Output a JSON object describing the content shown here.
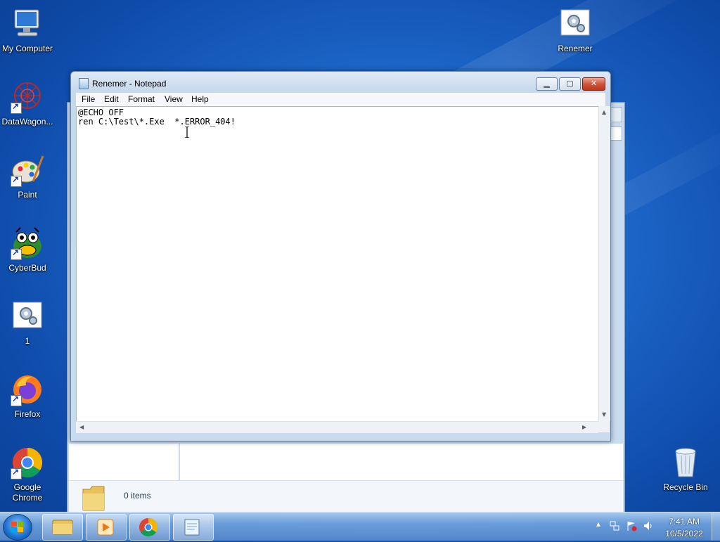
{
  "desktop": {
    "icons": [
      {
        "label": "My Computer"
      },
      {
        "label": "DataWagon..."
      },
      {
        "label": "Paint"
      },
      {
        "label": "CyberBud"
      },
      {
        "label": "1"
      },
      {
        "label": "Firefox"
      },
      {
        "label": "Google Chrome"
      },
      {
        "label": "Renemer"
      },
      {
        "label": "Recycle Bin"
      }
    ]
  },
  "explorer": {
    "status": "0 items"
  },
  "notepad": {
    "title": "Renemer - Notepad",
    "menu": [
      "File",
      "Edit",
      "Format",
      "View",
      "Help"
    ],
    "content": "@ECHO OFF\nren C:\\Test\\*.Exe  *.ERROR_404!"
  },
  "taskbar": {
    "buttons": [
      "windows-explorer",
      "media-player",
      "chrome",
      "notepad"
    ],
    "clock_time": "7:41 AM",
    "clock_date": "10/5/2022"
  },
  "colors": {
    "desktop": "#1a62c4",
    "close_button": "#c2341b"
  }
}
